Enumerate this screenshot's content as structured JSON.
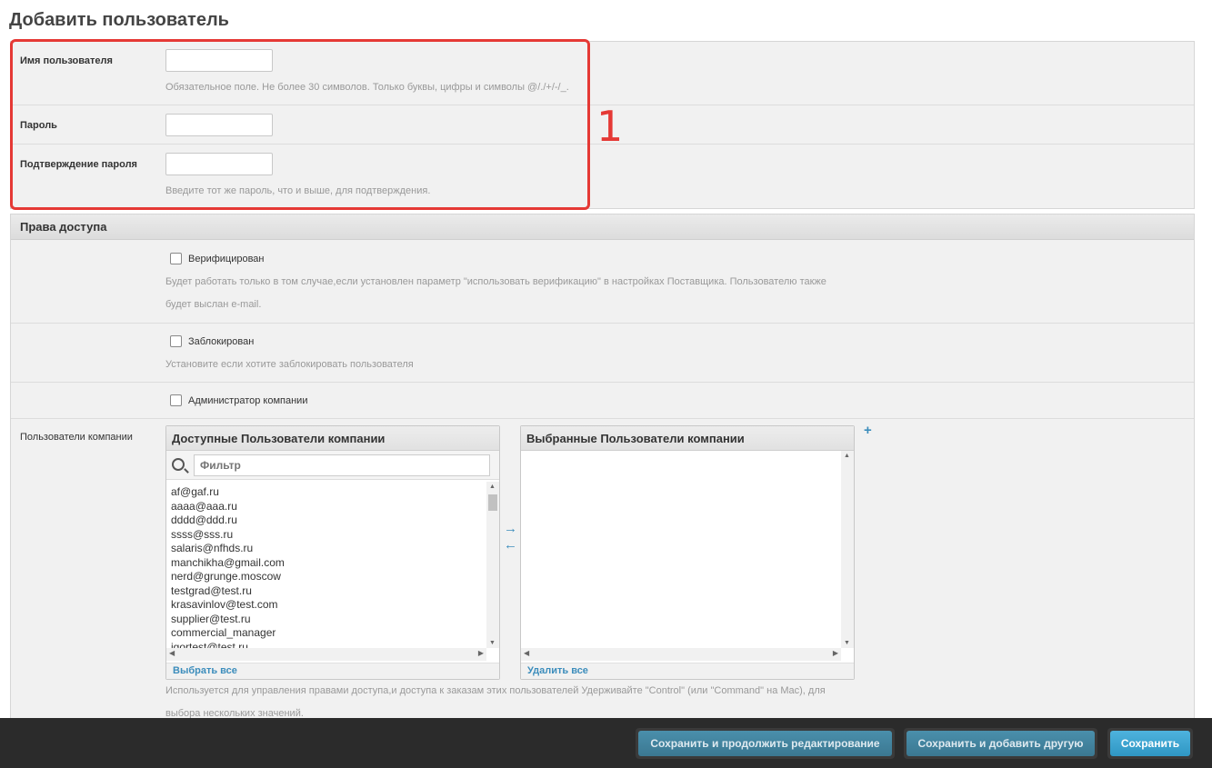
{
  "page": {
    "title": "Добавить пользователь"
  },
  "credentials": {
    "username_label": "Имя пользователя",
    "username_value": "",
    "username_help": "Обязательное поле. Не более 30 символов. Только буквы, цифры и символы @/./+/-/_.",
    "password_label": "Пароль",
    "password_value": "",
    "confirm_label": "Подтверждение пароля",
    "confirm_value": "",
    "confirm_help": "Введите тот же пароль, что и выше, для подтверждения."
  },
  "annotation": {
    "number": "1",
    "color": "#e53935"
  },
  "permissions": {
    "title": "Права доступа",
    "verified_label": "Верифицирован",
    "verified_checked": false,
    "verified_help_1": "Будет работать только в том случае,если установлен параметр \"использовать верификацию\" в настройках Поставщика. Пользователю также",
    "verified_help_2": "будет выслан e-mail.",
    "blocked_label": "Заблокирован",
    "blocked_checked": false,
    "blocked_help": "Установите если хотите заблокировать пользователя",
    "admin_label": "Администратор компании",
    "admin_checked": false
  },
  "company_users": {
    "label": "Пользователи компании",
    "available_title": "Доступные Пользователи компании",
    "filter_placeholder": "Фильтр",
    "available": [
      "af@gaf.ru",
      "aaaa@aaa.ru",
      "dddd@ddd.ru",
      "ssss@sss.ru",
      "salaris@nfhds.ru",
      "manchikha@gmail.com",
      "nerd@grunge.moscow",
      "testgrad@test.ru",
      "krasavinlov@test.com",
      "supplier@test.ru",
      "commercial_manager",
      "igortest@test.ru"
    ],
    "select_all": "Выбрать все",
    "chosen_title": "Выбранные Пользователи компании",
    "chosen": [],
    "remove_all": "Удалить все",
    "help_1": "Используется для управления правами доступа,и доступа к заказам этих пользователей Удерживайте \"Control\" (или \"Command\" на Mac), для",
    "help_2": "выбора нескольких значений."
  },
  "footer": {
    "save_continue": "Сохранить и продолжить редактирование",
    "save_add": "Сохранить и добавить другую",
    "save": "Сохранить"
  },
  "colors": {
    "accent": "#3c8dbc",
    "primary_button": "#2f97c4",
    "footer_bg": "#2b2b2b"
  }
}
